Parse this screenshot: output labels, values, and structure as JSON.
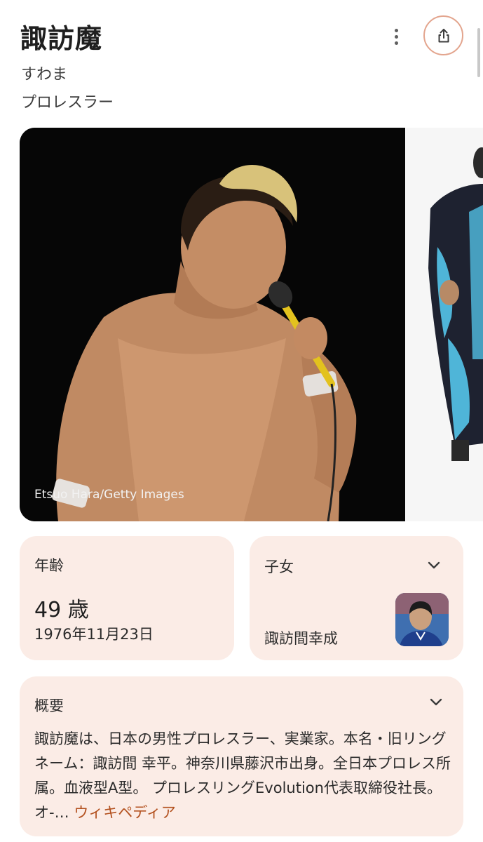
{
  "header": {
    "title": "諏訪魔",
    "reading": "すわま",
    "profession": "プロレスラー"
  },
  "icons": {
    "more": "more-vert-icon",
    "share": "share-icon",
    "chevron": "chevron-down-icon"
  },
  "image": {
    "credit": "Etsuo Hara/Getty Images"
  },
  "age_card": {
    "label": "年齢",
    "value": "49 歳",
    "birth_date": "1976年11月23日"
  },
  "child_card": {
    "label": "子女",
    "name": "諏訪間幸成"
  },
  "summary_card": {
    "label": "概要",
    "text": "諏訪魔は、日本の男性プロレスラー、実業家。本名・旧リングネーム：諏訪間 幸平。神奈川県藤沢市出身。全日本プロレス所属。血液型A型。 プロレスリングEvolution代表取締役社長。オ-…",
    "source_link": "ウィキペディア"
  },
  "colors": {
    "card_bg": "#fbece6",
    "accent_border": "#e3a58e",
    "link": "#b3511f"
  }
}
